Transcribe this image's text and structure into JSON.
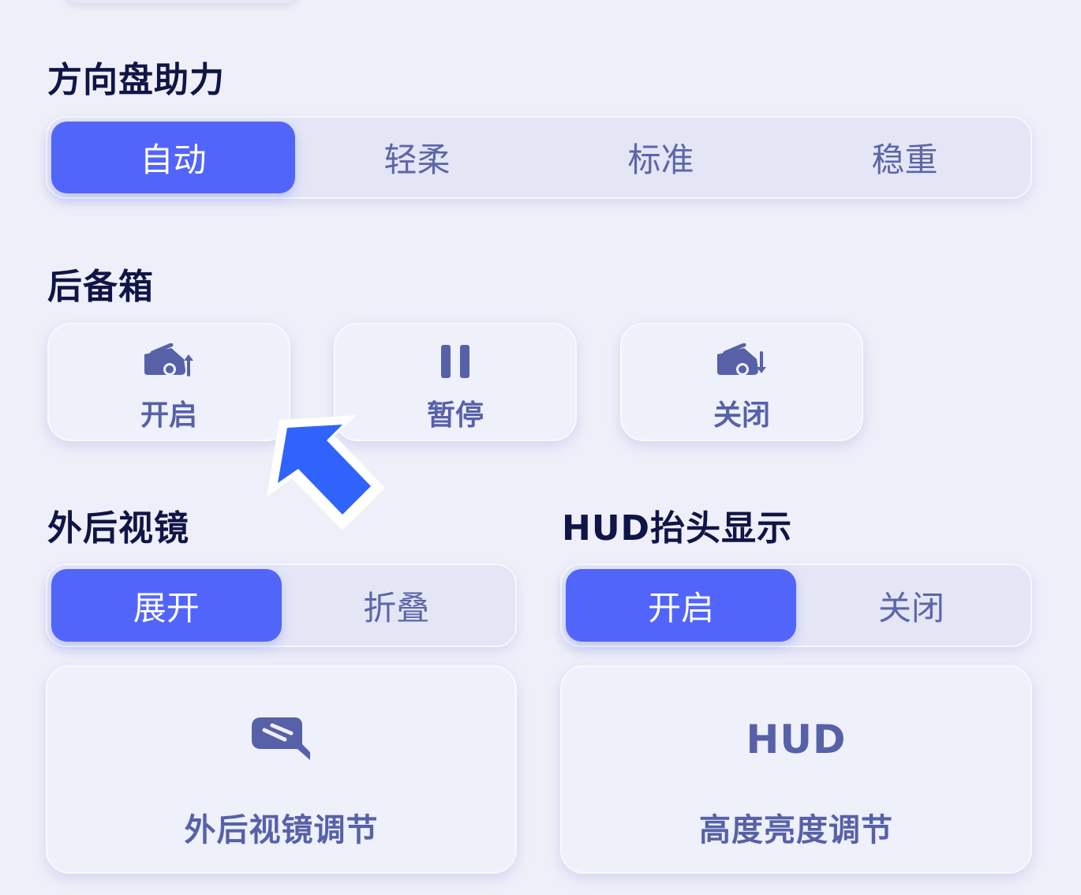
{
  "steering": {
    "title": "方向盘助力",
    "options": [
      "自动",
      "轻柔",
      "标准",
      "稳重"
    ],
    "selected": "自动"
  },
  "trunk": {
    "title": "后备箱",
    "buttons": [
      {
        "label": "开启",
        "icon": "trunk-open-icon"
      },
      {
        "label": "暂停",
        "icon": "pause-icon"
      },
      {
        "label": "关闭",
        "icon": "trunk-close-icon"
      }
    ]
  },
  "mirror": {
    "title": "外后视镜",
    "options": [
      "展开",
      "折叠"
    ],
    "selected": "展开",
    "adjust_label": "外后视镜调节",
    "adjust_icon": "side-mirror-icon"
  },
  "hud": {
    "title": "HUD抬头显示",
    "options": [
      "开启",
      "关闭"
    ],
    "selected": "开启",
    "icon_text": "HUD",
    "adjust_label": "高度亮度调节"
  },
  "pointer": {
    "icon": "cursor-arrow-icon",
    "color": "#2f63fb"
  },
  "colors": {
    "accent": "#5265fa",
    "background": "#eeeff9",
    "text_muted": "#5661a8"
  }
}
